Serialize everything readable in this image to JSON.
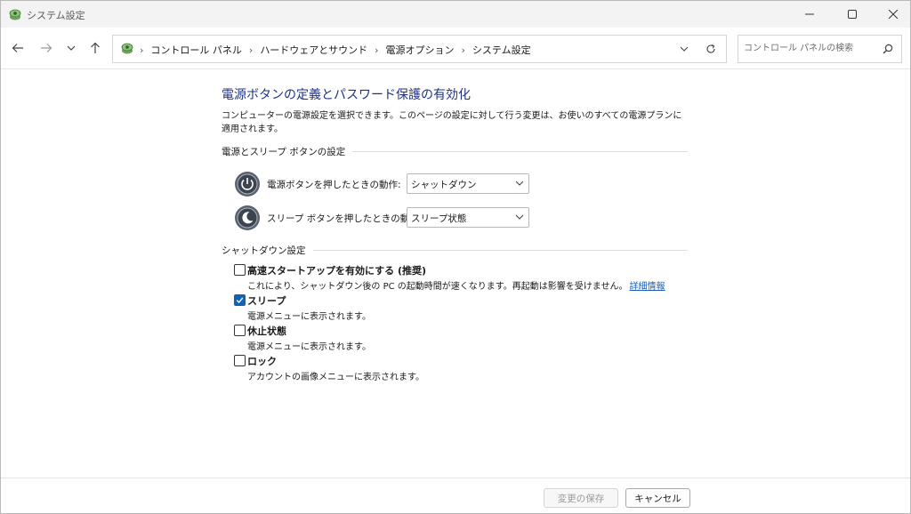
{
  "window": {
    "title": "システム設定",
    "controls": {
      "minimize": "minimize-icon",
      "maximize": "maximize-icon",
      "close": "close-icon"
    }
  },
  "nav": {
    "breadcrumbs": [
      "コントロール パネル",
      "ハードウェアとサウンド",
      "電源オプション",
      "システム設定"
    ],
    "search_placeholder": "コントロール パネルの検索"
  },
  "main": {
    "title": "電源ボタンの定義とパスワード保護の有効化",
    "description": "コンピューターの電源設定を選択できます。このページの設定に対して行う変更は、お使いのすべての電源プランに適用されます。",
    "power_section": {
      "heading": "電源とスリープ ボタンの設定",
      "power_button": {
        "label": "電源ボタンを押したときの動作:",
        "value": "シャットダウン"
      },
      "sleep_button": {
        "label": "スリープ ボタンを押したときの動作:",
        "value": "スリープ状態"
      }
    },
    "shutdown_section": {
      "heading": "シャットダウン設定",
      "items": [
        {
          "label": "高速スタートアップを有効にする (推奨)",
          "desc": "これにより、シャットダウン後の PC の起動時間が速くなります。再起動は影響を受けません。",
          "link": "詳細情報",
          "checked": false
        },
        {
          "label": "スリープ",
          "desc": "電源メニューに表示されます。",
          "checked": true
        },
        {
          "label": "休止状態",
          "desc": "電源メニューに表示されます。",
          "checked": false
        },
        {
          "label": "ロック",
          "desc": "アカウントの画像メニューに表示されます。",
          "checked": false
        }
      ]
    }
  },
  "footer": {
    "apply_label": "変更の保存",
    "cancel_label": "キャンセル"
  },
  "colors": {
    "title_blue": "#1e3287",
    "link_blue": "#1a5fb4",
    "check_blue": "#0f62b8"
  }
}
